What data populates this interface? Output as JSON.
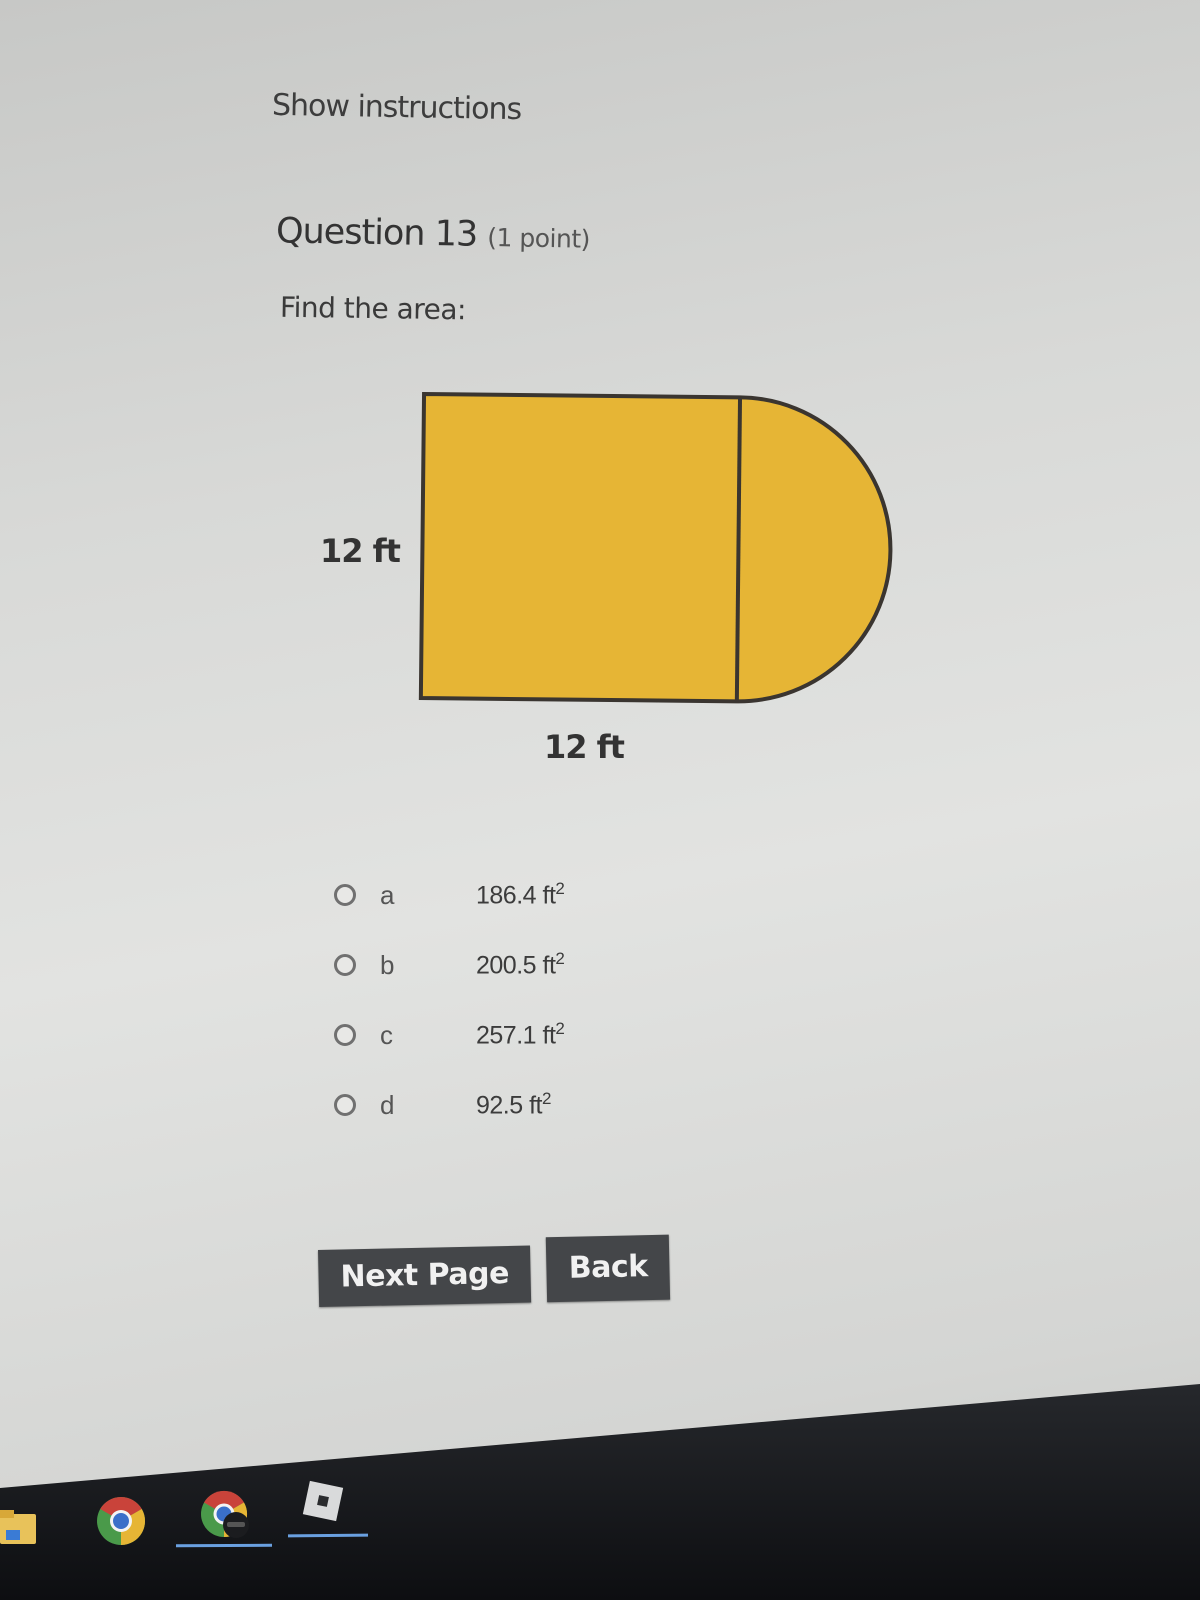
{
  "header": {
    "show_instructions_label": "Show instructions"
  },
  "question": {
    "title": "Question 13",
    "points": "(1 point)",
    "prompt": "Find the area:"
  },
  "figure": {
    "description": "Rectangle with a semicircle attached on the right side",
    "height_label": "12 ft",
    "width_label": "12 ft",
    "fill_color": "#e6b535",
    "stroke_color": "#3a3530"
  },
  "choices": [
    {
      "letter": "a",
      "value": "186.4 ft",
      "unit_exp": "2",
      "selected": false
    },
    {
      "letter": "b",
      "value": "200.5 ft",
      "unit_exp": "2",
      "selected": false
    },
    {
      "letter": "c",
      "value": "257.1 ft",
      "unit_exp": "2",
      "selected": false
    },
    {
      "letter": "d",
      "value": "92.5 ft",
      "unit_exp": "2",
      "selected": false
    }
  ],
  "buttons": {
    "next_label": "Next Page",
    "back_label": "Back"
  },
  "taskbar": {
    "icons": [
      "file-explorer-icon",
      "chrome-icon",
      "chrome-profile-icon",
      "roblox-icon"
    ]
  }
}
